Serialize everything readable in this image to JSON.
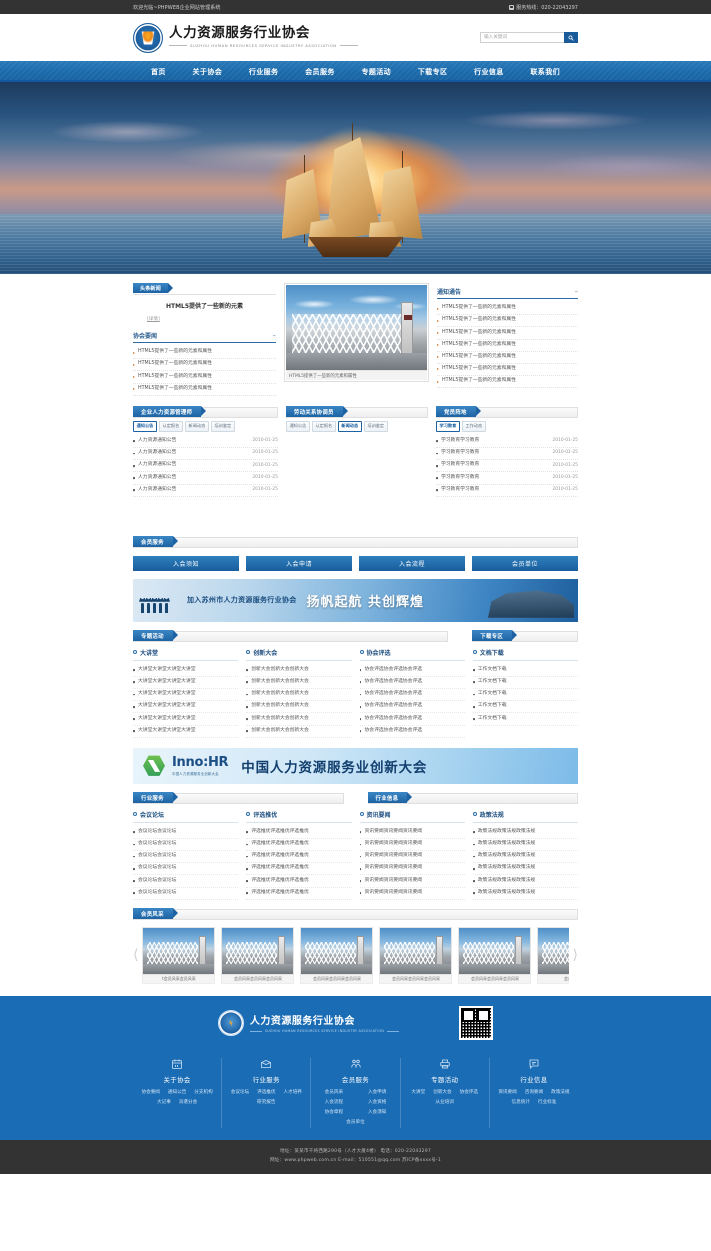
{
  "topbar": {
    "welcome": "欢迎光临~PHPWEB企业网站管理系统",
    "hotline": "服务热线：020-22043297",
    "phone_icon": "telephone-icon"
  },
  "header": {
    "logo_icon": "association-logo-icon",
    "title_cn": "人力资源服务行业协会",
    "title_en": "SUZHOU HUMAN RESOURCES SERVICE INDUSTRY ASSOCIATION",
    "search": {
      "placeholder": "输入关键词",
      "value": "",
      "button_icon": "search-icon"
    }
  },
  "nav": {
    "items": [
      {
        "label": "首页"
      },
      {
        "label": "关于协会"
      },
      {
        "label": "行业服务"
      },
      {
        "label": "会员服务"
      },
      {
        "label": "专题活动"
      },
      {
        "label": "下载专区"
      },
      {
        "label": "行业信息"
      },
      {
        "label": "联系我们"
      }
    ]
  },
  "banner": {
    "alt": "帆船日出横幅"
  },
  "news": {
    "headline": {
      "tab": "头条新闻",
      "title": "HTML5提供了一些新的元素",
      "more": "[详情]"
    },
    "assoc": {
      "title": "协会要闻",
      "more_icon": "more-icon",
      "items": [
        "HTML5提供了一些新的元素和属性",
        "HTML5提供了一些新的元素和属性",
        "HTML5提供了一些新的元素和属性",
        "HTML5提供了一些新的元素和属性"
      ]
    },
    "photo": {
      "caption": "HTML5提供了一些新的元素和属性"
    },
    "notice": {
      "title": "通知通告",
      "more_icon": "more-icon",
      "items": [
        "HTML5提供了一些新的元素和属性",
        "HTML5提供了一些新的元素和属性",
        "HTML5提供了一些新的元素和属性",
        "HTML5提供了一些新的元素和属性",
        "HTML5提供了一些新的元素和属性",
        "HTML5提供了一些新的元素和属性",
        "HTML5提供了一些新的元素和属性"
      ]
    }
  },
  "midblocks": [
    {
      "tag": "企业人力资源管理师",
      "tabs": [
        {
          "label": "通知公告",
          "active": true
        },
        {
          "label": "认定报名",
          "active": false
        },
        {
          "label": "新闻动态",
          "active": false
        },
        {
          "label": "培训鉴定",
          "active": false
        }
      ],
      "rows": [
        {
          "text": "人力资源通知公告",
          "date": "2010-01-25"
        },
        {
          "text": "人力资源通知公告",
          "date": "2010-01-25"
        },
        {
          "text": "人力资源通知公告",
          "date": "2010-01-25"
        },
        {
          "text": "人力资源通知公告",
          "date": "2010-01-25"
        },
        {
          "text": "人力资源通知公告",
          "date": "2010-01-25"
        }
      ]
    },
    {
      "tag": "劳动关系协调员",
      "tabs": [
        {
          "label": "通知公告",
          "active": false
        },
        {
          "label": "认定报名",
          "active": false
        },
        {
          "label": "新闻动态",
          "active": true
        },
        {
          "label": "培训鉴定",
          "active": false
        }
      ],
      "rows": []
    },
    {
      "tag": "党员阵地",
      "tabs": [
        {
          "label": "学习教育",
          "active": true
        },
        {
          "label": "工作动态",
          "active": false
        }
      ],
      "rows": [
        {
          "text": "学习教育学习教育",
          "date": "2010-01-25"
        },
        {
          "text": "学习教育学习教育",
          "date": "2010-01-25"
        },
        {
          "text": "学习教育学习教育",
          "date": "2010-01-25"
        },
        {
          "text": "学习教育学习教育",
          "date": "2010-01-25"
        },
        {
          "text": "学习教育学习教育",
          "date": "2010-01-25"
        }
      ]
    }
  ],
  "member_service": {
    "tag": "会员服务",
    "buttons": [
      "入会须知",
      "入会申请",
      "入会流程",
      "会员单位"
    ]
  },
  "ad_banner": {
    "text1": "加入苏州市人力资源服务行业协会",
    "text2": "扬帆起航 共创辉煌"
  },
  "topic": {
    "tag_left": "专题活动",
    "tag_right": "下载专区",
    "columns": [
      {
        "title": "大讲堂",
        "items": [
          "大讲堂大讲堂大讲堂大讲堂",
          "大讲堂大讲堂大讲堂大讲堂",
          "大讲堂大讲堂大讲堂大讲堂",
          "大讲堂大讲堂大讲堂大讲堂",
          "大讲堂大讲堂大讲堂大讲堂",
          "大讲堂大讲堂大讲堂大讲堂"
        ]
      },
      {
        "title": "创新大会",
        "items": [
          "创新大会创新大会创新大会",
          "创新大会创新大会创新大会",
          "创新大会创新大会创新大会",
          "创新大会创新大会创新大会",
          "创新大会创新大会创新大会",
          "创新大会创新大会创新大会"
        ]
      },
      {
        "title": "协会评选",
        "items": [
          "协会评选协会评选协会评选",
          "协会评选协会评选协会评选",
          "协会评选协会评选协会评选",
          "协会评选协会评选协会评选",
          "协会评选协会评选协会评选",
          "协会评选协会评选协会评选"
        ]
      },
      {
        "title": "文档下载",
        "items": [
          "工作文档下载",
          "工作文档下载",
          "工作文档下载",
          "工作文档下载",
          "工作文档下载"
        ]
      }
    ]
  },
  "innohr": {
    "brand": "Inno:HR",
    "brand_sub": "中国人力资源服务业创新大会",
    "title": "中国人力资源服务业创新大会",
    "logo_icon": "innohr-logo-icon"
  },
  "industry": {
    "tag_left": "行业服务",
    "tag_right": "行业信息",
    "columns": [
      {
        "title": "会议论坛",
        "items": [
          "会议论坛会议论坛",
          "会议论坛会议论坛",
          "会议论坛会议论坛",
          "会议论坛会议论坛",
          "会议论坛会议论坛",
          "会议论坛会议论坛"
        ]
      },
      {
        "title": "评选推优",
        "items": [
          "评选推优评选推优评选推优",
          "评选推优评选推优评选推优",
          "评选推优评选推优评选推优",
          "评选推优评选推优评选推优",
          "评选推优评选推优评选推优",
          "评选推优评选推优评选推优"
        ]
      },
      {
        "title": "资讯要闻",
        "items": [
          "资讯要闻资讯要闻资讯要闻",
          "资讯要闻资讯要闻资讯要闻",
          "资讯要闻资讯要闻资讯要闻",
          "资讯要闻资讯要闻资讯要闻",
          "资讯要闻资讯要闻资讯要闻",
          "资讯要闻资讯要闻资讯要闻"
        ]
      },
      {
        "title": "政策法规",
        "items": [
          "政策法规政策法规政策法规",
          "政策法规政策法规政策法规",
          "政策法规政策法规政策法规",
          "政策法规政策法规政策法规",
          "政策法规政策法规政策法规",
          "政策法规政策法规政策法规"
        ]
      }
    ]
  },
  "gallery": {
    "tag": "会员风采",
    "prev_icon": "chevron-left-icon",
    "next_icon": "chevron-right-icon",
    "items": [
      {
        "caption": "t会员风采会员风采"
      },
      {
        "caption": "会员风采会员风采会员风采"
      },
      {
        "caption": "会员风采会员风采会员风采"
      },
      {
        "caption": "会员风采会员风采会员风采"
      },
      {
        "caption": "会员风采会员风采会员风采"
      },
      {
        "caption": "会员风采会"
      }
    ]
  },
  "footer": {
    "brand_cn": "人力资源服务行业协会",
    "brand_en": "SUZHOU HUMAN RESOURCES SERVICE INDUSTRY ASSOCIATION",
    "logo_icon": "association-logo-icon",
    "qr_icon": "qr-code-icon",
    "columns": [
      {
        "icon": "calendar-icon",
        "head": "关于协会",
        "links": [
          "协会要闻",
          "通知公告",
          "分支机构",
          "大记事",
          "派遣分会"
        ]
      },
      {
        "icon": "briefcase-icon",
        "head": "行业服务",
        "links": [
          "会议论坛",
          "评选推优",
          "人才培养",
          "研究报告"
        ]
      },
      {
        "icon": "people-icon",
        "head": "会员服务",
        "links": [
          "会员风采",
          "入会申请",
          "入会流程",
          "入会资格",
          "协会章程",
          "入会须知",
          "会员单位"
        ]
      },
      {
        "icon": "printer-icon",
        "head": "专题活动",
        "links": [
          "大讲堂",
          "创新大会",
          "协会评选",
          "从业培训"
        ]
      },
      {
        "icon": "chat-icon",
        "head": "行业信息",
        "links": [
          "资讯要闻",
          "咨询要闻",
          "政策法规",
          "信息统计",
          "行业标准"
        ]
      }
    ]
  },
  "copyright": {
    "line1": "地址：某某市干将西路290号（人才大厦4楼）    电话：020-22043297",
    "line2": "网址：www.phpweb.com.cn   E-mail：510551@qq.com 苏ICP备xxxx号-1"
  }
}
